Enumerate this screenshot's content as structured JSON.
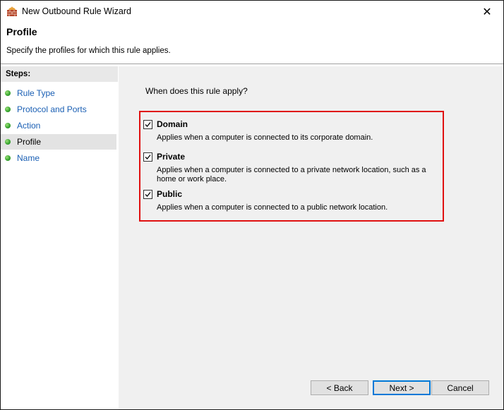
{
  "window": {
    "title": "New Outbound Rule Wizard",
    "close_glyph": "✕"
  },
  "header": {
    "title": "Profile",
    "subtitle": "Specify the profiles for which this rule applies."
  },
  "sidebar": {
    "title": "Steps:",
    "items": [
      {
        "label": "Rule Type",
        "active": false
      },
      {
        "label": "Protocol and Ports",
        "active": false
      },
      {
        "label": "Action",
        "active": false
      },
      {
        "label": "Profile",
        "active": true
      },
      {
        "label": "Name",
        "active": false
      }
    ]
  },
  "main": {
    "question": "When does this rule apply?",
    "options": [
      {
        "name": "Domain",
        "checked": true,
        "desc": "Applies when a computer is connected to its corporate domain."
      },
      {
        "name": "Private",
        "checked": true,
        "desc": "Applies when a computer is connected to a private network location, such as a home or work place."
      },
      {
        "name": "Public",
        "checked": true,
        "desc": "Applies when a computer is connected to a public network location."
      }
    ]
  },
  "buttons": {
    "back": "< Back",
    "next": "Next >",
    "cancel": "Cancel"
  },
  "colors": {
    "highlight": "#e01010",
    "link": "#1a5fb4",
    "content_bg": "#f0f0f0",
    "step_dot": "#3aa832"
  }
}
